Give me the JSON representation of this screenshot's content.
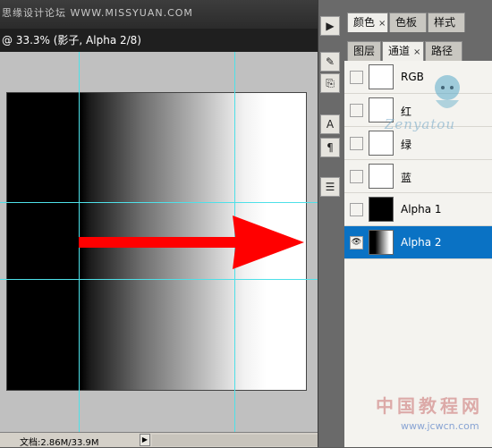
{
  "document": {
    "watermark_top": "思缘设计论坛 WWW.MISSYUAN.COM",
    "title": "@ 33.3% (影子, Alpha 2/8)",
    "status_doc": "文档:2.86M/33.9M"
  },
  "panels": {
    "top_tabs": [
      {
        "label": "颜色",
        "close": "×"
      },
      {
        "label": "色板",
        "close": ""
      },
      {
        "label": "样式",
        "close": ""
      }
    ],
    "channel_tabs": [
      {
        "label": "图层",
        "close": ""
      },
      {
        "label": "通道",
        "close": "×"
      },
      {
        "label": "路径",
        "close": ""
      }
    ],
    "channels": [
      {
        "name": "RGB",
        "visible": false,
        "selected": false
      },
      {
        "name": "红",
        "visible": false,
        "selected": false
      },
      {
        "name": "绿",
        "visible": false,
        "selected": false
      },
      {
        "name": "蓝",
        "visible": false,
        "selected": false
      },
      {
        "name": "Alpha 1",
        "visible": false,
        "selected": false
      },
      {
        "name": "Alpha 2",
        "visible": true,
        "selected": true
      }
    ]
  },
  "watermarks": {
    "script": "Zenyatou",
    "bottom": "中国教程网",
    "bottom_url": "www.jcwcn.com"
  },
  "icons": {
    "eye": "eye-icon",
    "play": "play-icon",
    "strip": [
      "play-icon",
      "brush-presets-icon",
      "clone-source-icon",
      "character-icon",
      "paragraph-icon",
      "layer-comps-icon"
    ]
  },
  "colors": {
    "selection": "#0a72c4",
    "guide": "#4ee0e8",
    "arrow": "#ff0000"
  }
}
